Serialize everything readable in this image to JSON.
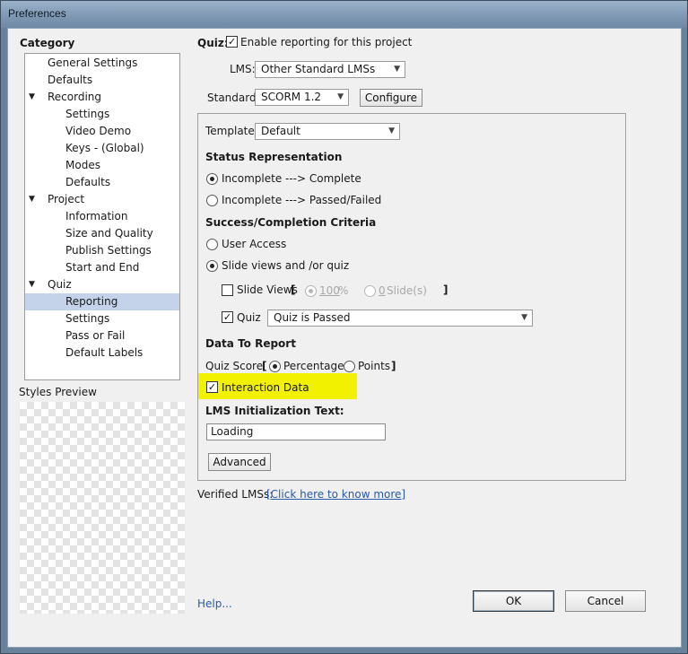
{
  "window": {
    "title": "Preferences"
  },
  "sidebar": {
    "heading": "Category",
    "items": [
      {
        "label": "General Settings",
        "level": 1,
        "expanded": null,
        "selected": false
      },
      {
        "label": "Defaults",
        "level": 1,
        "expanded": null,
        "selected": false
      },
      {
        "label": "Recording",
        "level": 1,
        "expanded": true,
        "selected": false
      },
      {
        "label": "Settings",
        "level": 2,
        "expanded": null,
        "selected": false
      },
      {
        "label": "Video Demo",
        "level": 2,
        "expanded": null,
        "selected": false
      },
      {
        "label": "Keys - (Global)",
        "level": 2,
        "expanded": null,
        "selected": false
      },
      {
        "label": "Modes",
        "level": 2,
        "expanded": null,
        "selected": false
      },
      {
        "label": "Defaults",
        "level": 2,
        "expanded": null,
        "selected": false
      },
      {
        "label": "Project",
        "level": 1,
        "expanded": true,
        "selected": false
      },
      {
        "label": "Information",
        "level": 2,
        "expanded": null,
        "selected": false
      },
      {
        "label": "Size and Quality",
        "level": 2,
        "expanded": null,
        "selected": false
      },
      {
        "label": "Publish Settings",
        "level": 2,
        "expanded": null,
        "selected": false
      },
      {
        "label": "Start and End",
        "level": 2,
        "expanded": null,
        "selected": false
      },
      {
        "label": "Quiz",
        "level": 1,
        "expanded": true,
        "selected": false
      },
      {
        "label": "Reporting",
        "level": 2,
        "expanded": null,
        "selected": true
      },
      {
        "label": "Settings",
        "level": 2,
        "expanded": null,
        "selected": false
      },
      {
        "label": "Pass or Fail",
        "level": 2,
        "expanded": null,
        "selected": false
      },
      {
        "label": "Default Labels",
        "level": 2,
        "expanded": null,
        "selected": false
      }
    ],
    "styles_preview_label": "Styles Preview"
  },
  "main": {
    "quiz_label": "Quiz:",
    "enable_reporting": {
      "label": "Enable reporting for this project",
      "checked": true
    },
    "lms": {
      "label": "LMS:",
      "value": "Other Standard LMSs"
    },
    "standard": {
      "label": "Standard:",
      "value": "SCORM 1.2",
      "configure_label": "Configure"
    },
    "template": {
      "label": "Template:",
      "value": "Default"
    },
    "status_representation": {
      "heading": "Status Representation",
      "options": [
        {
          "label": "Incomplete ---> Complete",
          "checked": true
        },
        {
          "label": "Incomplete ---> Passed/Failed",
          "checked": false
        }
      ]
    },
    "criteria": {
      "heading": "Success/Completion Criteria",
      "user_access": {
        "label": "User Access",
        "checked": false
      },
      "slide_views_quiz": {
        "label": "Slide views and /or quiz",
        "checked": true
      },
      "slide_views": {
        "label": "Slide Views",
        "checked": false,
        "bracket_open": "[",
        "bracket_close": "]",
        "percent_value": "100",
        "percent_unit": "%",
        "percent_checked": true,
        "slides_value": "0",
        "slides_unit": "Slide(s)",
        "slides_checked": false
      },
      "quiz": {
        "label": "Quiz",
        "checked": true,
        "value": "Quiz is Passed"
      }
    },
    "data_to_report": {
      "heading": "Data To Report",
      "quiz_score_label": "Quiz Score",
      "bracket_open": "[",
      "bracket_close": "]",
      "percentage": {
        "label": "Percentage",
        "checked": true
      },
      "points": {
        "label": "Points",
        "checked": false
      },
      "interaction_data": {
        "label": "Interaction Data",
        "checked": true
      }
    },
    "lms_init": {
      "label": "LMS Initialization Text:",
      "value": "Loading"
    },
    "advanced_label": "Advanced",
    "verified_lms": {
      "label": "Verified LMSs:",
      "link": "[Click here to know more]"
    }
  },
  "footer": {
    "help_label": "Help...",
    "ok_label": "OK",
    "cancel_label": "Cancel"
  },
  "colors": {
    "highlight": "#f2f200",
    "selected_row": "#c4d3ea",
    "link": "#2a5aa8"
  },
  "checkmark_glyph": "✓"
}
